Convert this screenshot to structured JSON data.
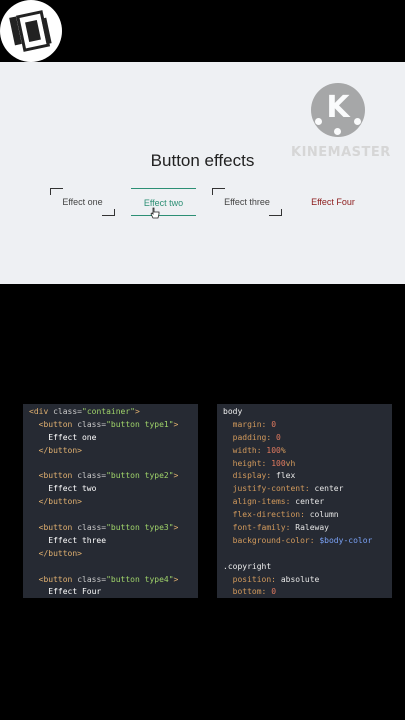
{
  "logo": {
    "brand": "KINEMASTER",
    "letter": "K"
  },
  "preview": {
    "title": "Button effects",
    "buttons": [
      {
        "label": "Effect one",
        "hovered": false
      },
      {
        "label": "Effect two",
        "hovered": true
      },
      {
        "label": "Effect three",
        "hovered": false
      },
      {
        "label": "Effect Four",
        "hovered": false
      }
    ],
    "colors": {
      "effect_two": "#2c8f74",
      "effect_four": "#8c1c1c",
      "background": "#eef0f3"
    }
  },
  "html_code": {
    "lines": [
      [
        "<div class=\"container\">"
      ],
      [
        "  <button class=\"button type1\">"
      ],
      [
        "    Effect one"
      ],
      [
        "  </button>"
      ],
      [
        ""
      ],
      [
        "  <button class=\"button type2\">"
      ],
      [
        "    Effect two"
      ],
      [
        "  </button>"
      ],
      [
        ""
      ],
      [
        "  <button class=\"button type3\">"
      ],
      [
        "    Effect three"
      ],
      [
        "  </button>"
      ],
      [
        ""
      ],
      [
        "  <button class=\"button type4\">"
      ],
      [
        "    Effect Four"
      ]
    ]
  },
  "css_code": {
    "lines": [
      "body",
      "  margin: 0",
      "  padding: 0",
      "  width: 100%",
      "  height: 100vh",
      "  display: flex",
      "  justify-content: center",
      "  align-items: center",
      "  flex-direction: column",
      "  font-family: Raleway",
      "  background-color: $body-color",
      "",
      ".copyright",
      "  position: absolute",
      "  bottom: 0"
    ]
  }
}
